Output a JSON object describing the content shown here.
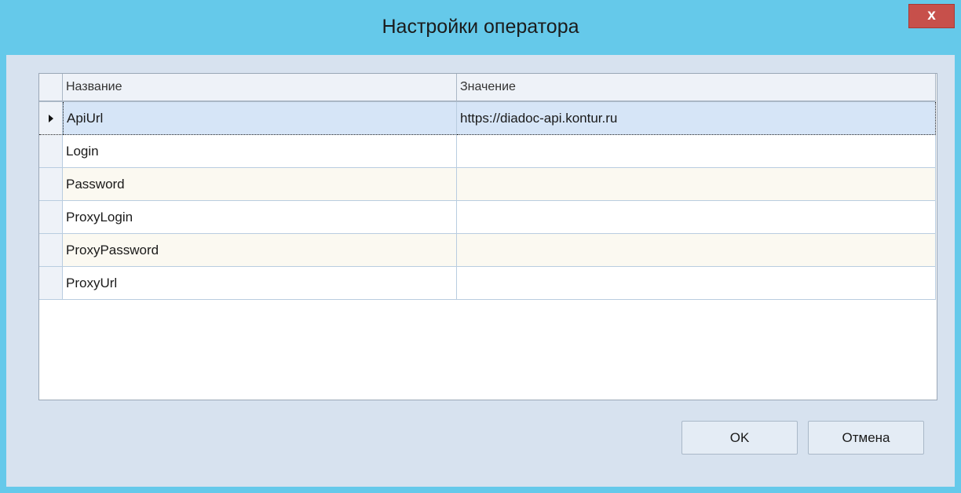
{
  "window": {
    "title": "Настройки оператора",
    "close_label": "x"
  },
  "grid": {
    "columns": [
      "Название",
      "Значение"
    ],
    "rows": [
      {
        "name": "ApiUrl",
        "value": "https://diadoc-api.kontur.ru",
        "selected": true
      },
      {
        "name": "Login",
        "value": ""
      },
      {
        "name": "Password",
        "value": ""
      },
      {
        "name": "ProxyLogin",
        "value": ""
      },
      {
        "name": "ProxyPassword",
        "value": ""
      },
      {
        "name": "ProxyUrl",
        "value": ""
      }
    ]
  },
  "buttons": {
    "ok_label": "OK",
    "cancel_label": "Отмена"
  },
  "colors": {
    "titlebar": "#65c9ea",
    "client_bg": "#d7e2ef",
    "close_button": "#c7504b",
    "selected_row": "#d6e5f7",
    "alt_row": "#fbf9f1"
  }
}
